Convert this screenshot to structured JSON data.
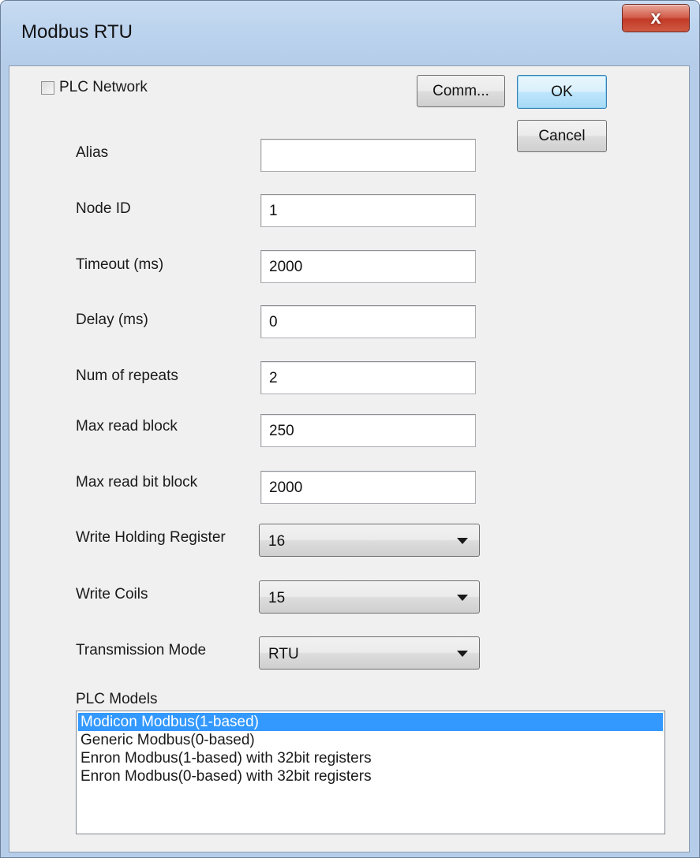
{
  "window": {
    "title": "Modbus RTU",
    "close_glyph": "x"
  },
  "checkbox": {
    "label": "PLC Network",
    "checked": false
  },
  "buttons": {
    "comm": "Comm...",
    "ok": "OK",
    "cancel": "Cancel"
  },
  "fields": [
    {
      "label": "Alias",
      "value": ""
    },
    {
      "label": "Node ID",
      "value": "1"
    },
    {
      "label": "Timeout (ms)",
      "value": "2000"
    },
    {
      "label": "Delay (ms)",
      "value": "0"
    },
    {
      "label": "Num of repeats",
      "value": "2"
    },
    {
      "label": "Max read block",
      "value": "250"
    },
    {
      "label": "Max read bit block",
      "value": "2000"
    }
  ],
  "selects": [
    {
      "label": "Write Holding Register",
      "value": "16"
    },
    {
      "label": "Write Coils",
      "value": "15"
    },
    {
      "label": "Transmission Mode",
      "value": "RTU"
    }
  ],
  "plc_models": {
    "label": "PLC Models",
    "selected_index": 0,
    "items": [
      "Modicon Modbus(1-based)",
      "Generic Modbus(0-based)",
      "Enron Modbus(1-based) with 32bit registers",
      "Enron Modbus(0-based) with 32bit registers"
    ]
  },
  "icons": {
    "close": "close-icon",
    "dropdown": "chevron-down-icon",
    "checkbox": "checkbox-icon"
  }
}
